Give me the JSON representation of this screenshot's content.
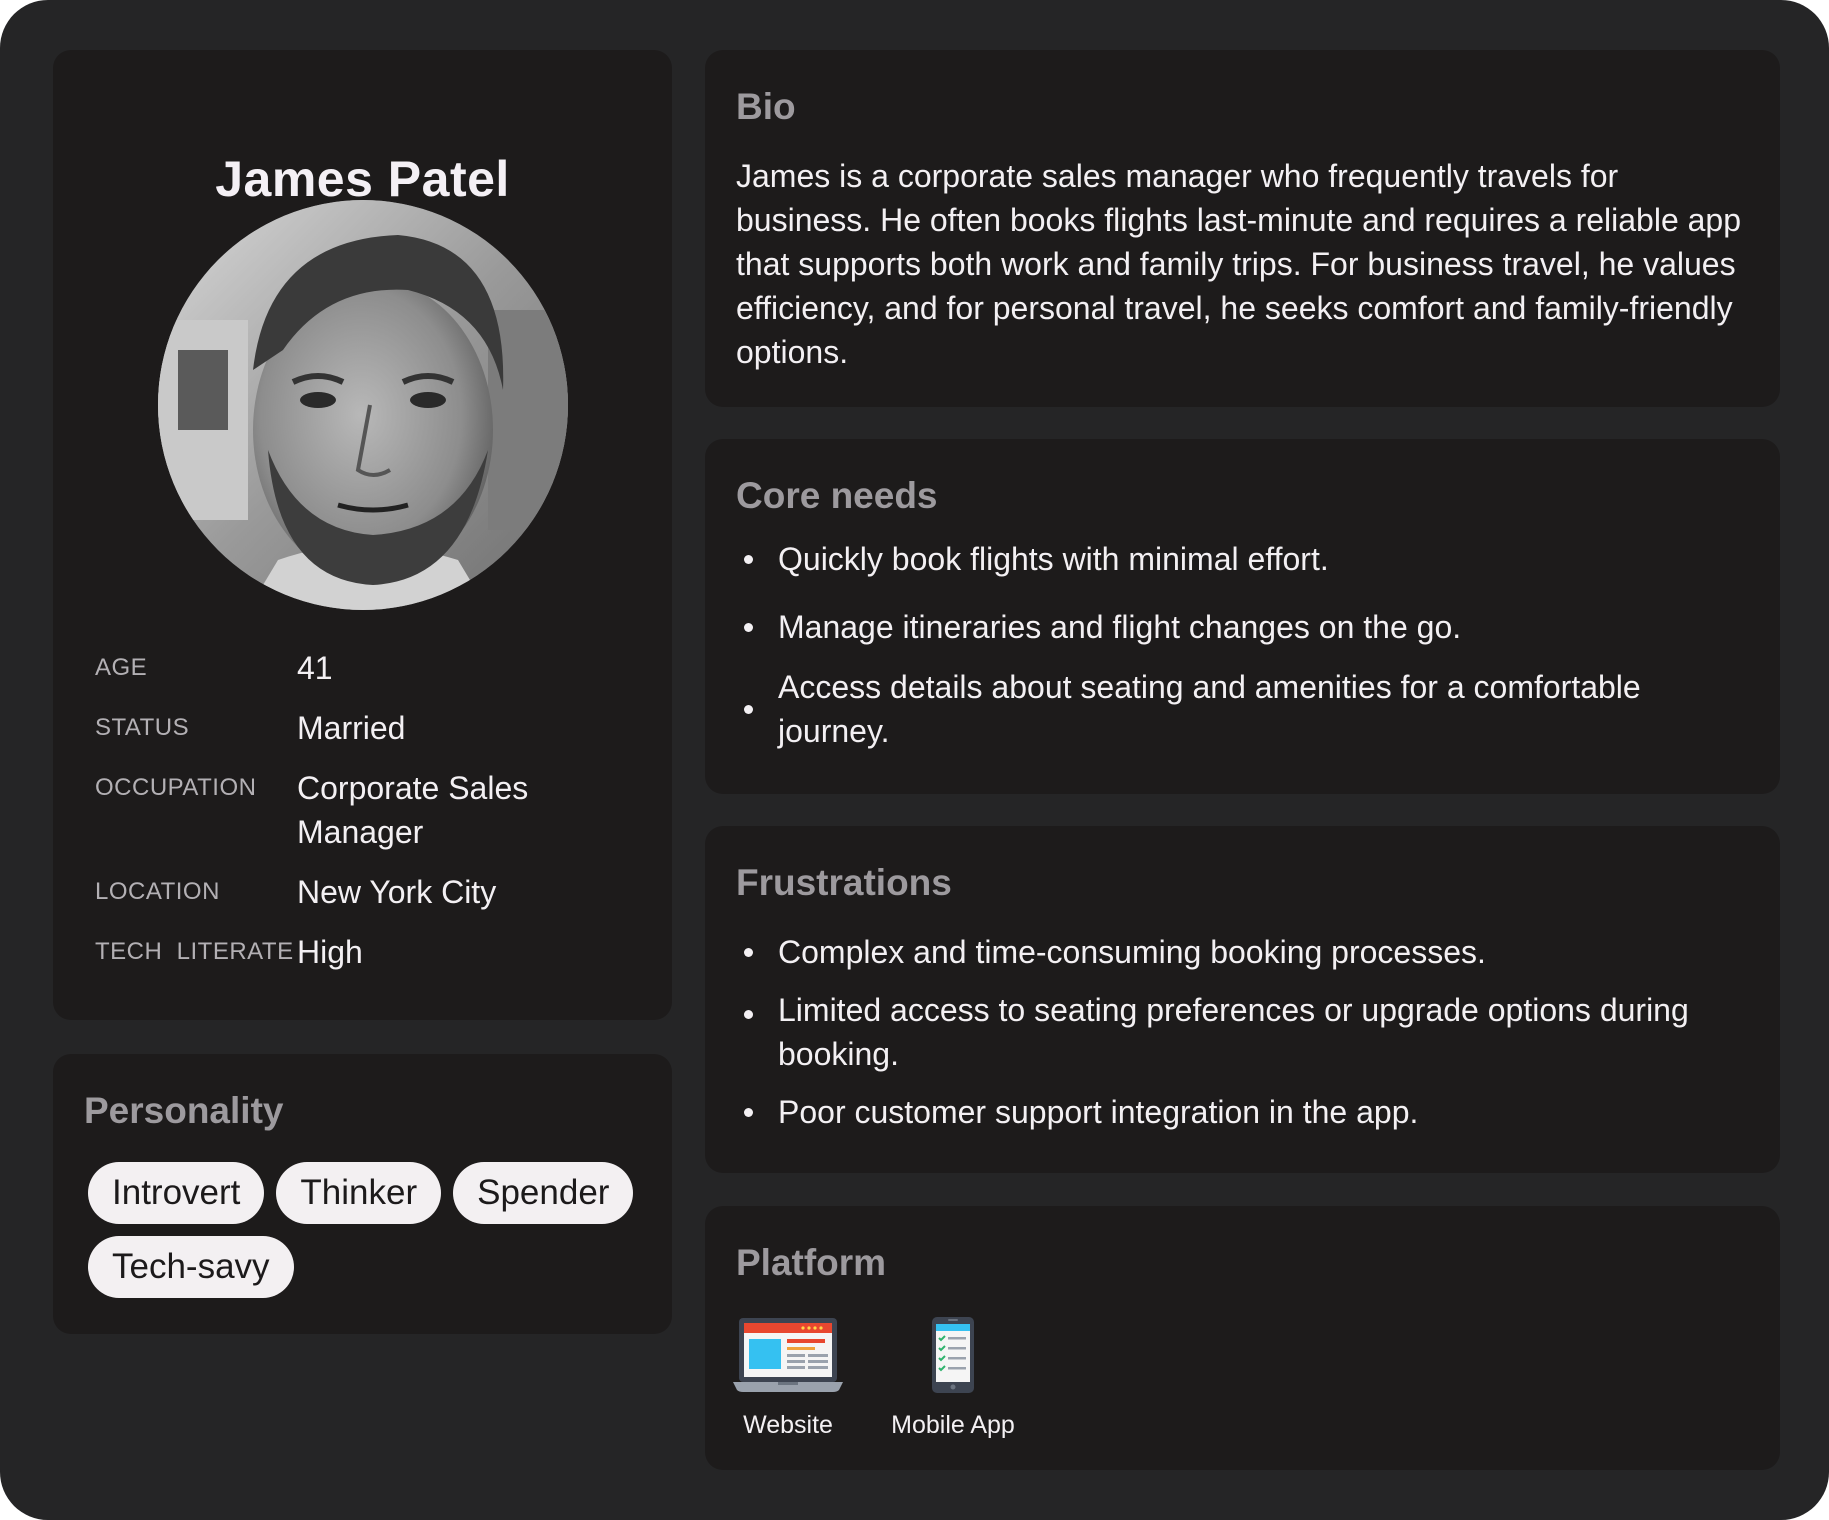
{
  "profile": {
    "name": "James Patel",
    "attributes": [
      {
        "label": "AGE",
        "value": "41"
      },
      {
        "label": "STATUS",
        "value": "Married"
      },
      {
        "label": "OCCUPATION",
        "value": "Corporate Sales Manager"
      },
      {
        "label": "LOCATION",
        "value": "New York City"
      },
      {
        "label": "TECH  LITERATE",
        "value": "High"
      }
    ]
  },
  "personality": {
    "title": "Personality",
    "tags": [
      "Introvert",
      "Thinker",
      "Spender",
      "Tech-savy"
    ]
  },
  "bio": {
    "title": "Bio",
    "text": "James is a corporate sales manager who frequently travels for business. He often books flights last-minute and requires a reliable app that supports both work and family trips. For business travel, he values efficiency, and for personal travel, he seeks comfort and family-friendly options."
  },
  "core_needs": {
    "title": "Core needs",
    "items": [
      "Quickly book flights with minimal effort.",
      "Manage itineraries and flight changes on the go.",
      "Access details about seating and amenities for a comfortable journey."
    ]
  },
  "frustrations": {
    "title": "Frustrations",
    "items": [
      "Complex and time-consuming booking processes.",
      "Limited access to seating preferences or upgrade options during booking.",
      "Poor customer support integration in the app."
    ]
  },
  "platform": {
    "title": "Platform",
    "items": [
      {
        "label": "Website",
        "icon": "laptop-website-icon"
      },
      {
        "label": "Mobile App",
        "icon": "mobile-app-icon"
      }
    ]
  }
}
